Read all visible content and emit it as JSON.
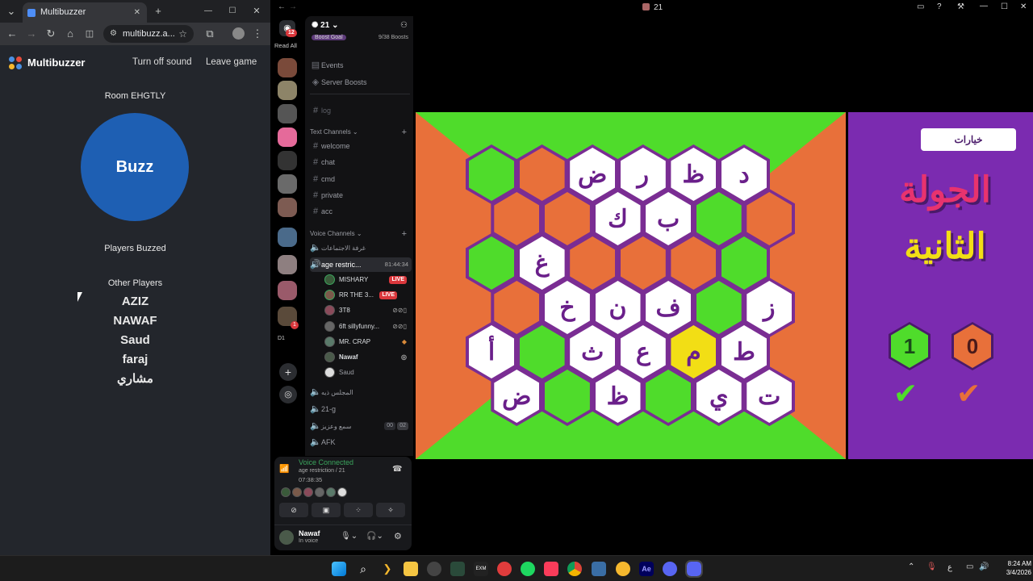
{
  "chrome": {
    "tab_title": "Multibuzzer",
    "url": "multibuzz.a...",
    "new_tab": "+",
    "tab_close": "✕",
    "win_min": "—",
    "win_max": "☐",
    "win_close": "✕"
  },
  "multibuzzer": {
    "brand": "Multibuzzer",
    "turn_off_sound": "Turn off sound",
    "leave_game": "Leave game",
    "room": "Room EHGTLY",
    "buzz": "Buzz",
    "players_buzzed": "Players Buzzed",
    "other_players_heading": "Other Players",
    "players": [
      "AZIZ",
      "NAWAF",
      "Saud",
      "faraj",
      "مشاري"
    ]
  },
  "discord": {
    "window_title": "21",
    "read_all": "Read All",
    "mention_badge": "12",
    "server_badge": "1",
    "server_label_bottom": "D1",
    "server_name": "21",
    "boost_goal": "Boost Goal",
    "boost_count": "9/38 Boosts",
    "events": "Events",
    "server_boosts": "Server Boosts",
    "log_channel": "log",
    "text_channels_header": "Text Channels",
    "text_channels": [
      "welcome",
      "chat",
      "cmd",
      "private",
      "acc"
    ],
    "voice_channels_header": "Voice Channels",
    "voice_channel_first": "غرفة الاجتماعات",
    "active_voice": "age restric...",
    "active_voice_time": "81:44:34",
    "voice_users": [
      {
        "name": "MISHARY",
        "live": true
      },
      {
        "name": "RR THE 3...",
        "live": true
      },
      {
        "name": "3T8",
        "live": false
      },
      {
        "name": "6ft sillyfunny...",
        "live": false
      },
      {
        "name": "MR. CRAP",
        "live": false
      },
      {
        "name": "Nawaf",
        "live": false
      },
      {
        "name": "Saud",
        "live": false
      }
    ],
    "live_label": "LIVE",
    "other_voice_channels": [
      "المجلس ذيه",
      "21-g",
      "سمع وعزيز",
      "AFK"
    ],
    "stage_count_a": "00",
    "stage_count_b": "02",
    "voice_connected": "Voice Connected",
    "voice_channel_path": "age restriction / 21",
    "voice_timer": "07:38:35",
    "user_name": "Nawaf",
    "user_status": "In voice"
  },
  "game": {
    "options_button": "خيارات",
    "round_title_line1": "الجولة",
    "round_title_line2": "الثانية",
    "green_team_score": "1",
    "orange_team_score": "0",
    "check_mark": "✔",
    "cells": [
      {
        "letter": "",
        "color": "green"
      },
      {
        "letter": "",
        "color": "orange"
      },
      {
        "letter": "ض",
        "color": "white"
      },
      {
        "letter": "ر",
        "color": "white"
      },
      {
        "letter": "ظ",
        "color": "white"
      },
      {
        "letter": "د",
        "color": "white"
      },
      {
        "letter": "",
        "color": "orange"
      },
      {
        "letter": "",
        "color": "orange"
      },
      {
        "letter": "ك",
        "color": "white"
      },
      {
        "letter": "ب",
        "color": "white"
      },
      {
        "letter": "",
        "color": "green"
      },
      {
        "letter": "",
        "color": "orange"
      },
      {
        "letter": "",
        "color": "green"
      },
      {
        "letter": "غ",
        "color": "white"
      },
      {
        "letter": "",
        "color": "orange"
      },
      {
        "letter": "",
        "color": "orange"
      },
      {
        "letter": "",
        "color": "orange"
      },
      {
        "letter": "",
        "color": "green"
      },
      {
        "letter": "",
        "color": "orange"
      },
      {
        "letter": "خ",
        "color": "white"
      },
      {
        "letter": "ن",
        "color": "white"
      },
      {
        "letter": "ف",
        "color": "white"
      },
      {
        "letter": "",
        "color": "green"
      },
      {
        "letter": "ز",
        "color": "white"
      },
      {
        "letter": "أ",
        "color": "white"
      },
      {
        "letter": "",
        "color": "green"
      },
      {
        "letter": "ث",
        "color": "white"
      },
      {
        "letter": "ع",
        "color": "white"
      },
      {
        "letter": "م",
        "color": "yellow"
      },
      {
        "letter": "ط",
        "color": "white"
      },
      {
        "letter": "ض",
        "color": "white"
      },
      {
        "letter": "",
        "color": "green"
      },
      {
        "letter": "ظ",
        "color": "white"
      },
      {
        "letter": "",
        "color": "green"
      },
      {
        "letter": "ي",
        "color": "white"
      },
      {
        "letter": "ت",
        "color": "white"
      }
    ],
    "colors": {
      "green": "#4fdc2b",
      "orange": "#e8703a",
      "purple": "#7b2bb0",
      "yellow": "#f2de15"
    }
  },
  "taskbar": {
    "lang": "ع",
    "time": "8:24 AM",
    "date": "3/4/2026"
  }
}
